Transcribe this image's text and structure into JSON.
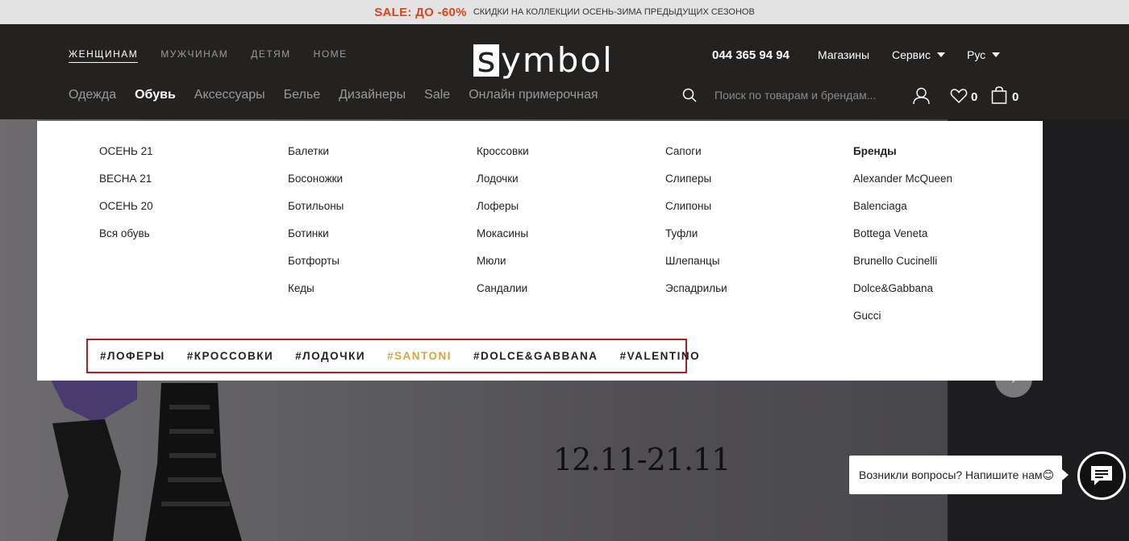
{
  "promo": {
    "sale": "SALE: ДО -60%",
    "text": "СКИДКИ НА КОЛЛЕКЦИИ ОСЕНЬ-ЗИМА ПРЕДЫДУЩИХ СЕЗОНОВ"
  },
  "header": {
    "top_nav": [
      "ЖЕНЩИНАМ",
      "МУЖЧИНАМ",
      "ДЕТЯМ",
      "HOME"
    ],
    "logo": {
      "box_letter": "s",
      "rest": "ymbol"
    },
    "phone": "044 365 94 94",
    "stores": "Магазины",
    "service": "Сервис",
    "lang": "Рус",
    "cat_nav": [
      "Одежда",
      "Обувь",
      "Аксессуары",
      "Белье",
      "Дизайнеры",
      "Sale",
      "Онлайн примерочная"
    ],
    "search_placeholder": "Поиск по товарам и брендам...",
    "wishlist_count": "0",
    "cart_count": "0"
  },
  "mega_menu": {
    "col1": [
      "ОСЕНЬ 21",
      "ВЕСНА 21",
      "ОСЕНЬ 20",
      "Вся обувь"
    ],
    "col2": [
      "Балетки",
      "Босоножки",
      "Ботильоны",
      "Ботинки",
      "Ботфорты",
      "Кеды"
    ],
    "col3": [
      "Кроссовки",
      "Лодочки",
      "Лоферы",
      "Мокасины",
      "Мюли",
      "Сандалии"
    ],
    "col4": [
      "Сапоги",
      "Слиперы",
      "Слипоны",
      "Туфли",
      "Шлепанцы",
      "Эспадрильи"
    ],
    "brands_title": "Бренды",
    "brands": [
      "Alexander McQueen",
      "Balenciaga",
      "Bottega Veneta",
      "Brunello Cucinelli",
      "Dolce&Gabbana",
      "Gucci"
    ],
    "tags": [
      "#ЛОФЕРЫ",
      "#КРОССОВКИ",
      "#ЛОДОЧКИ",
      "#SANTONI",
      "#DOLCE&GABBANA",
      "#VALENTINO"
    ]
  },
  "hero": {
    "date": "12.11-21.11"
  },
  "chat": {
    "text": "Возникли вопросы? Напишите нам😊"
  },
  "colors": {
    "accent": "#d9451f",
    "tag_highlight": "#e0a03a",
    "header_bg": "#232221"
  },
  "icons": [
    "search-icon",
    "user-icon",
    "heart-icon",
    "bag-icon",
    "chevron-right-icon",
    "chat-icon"
  ]
}
